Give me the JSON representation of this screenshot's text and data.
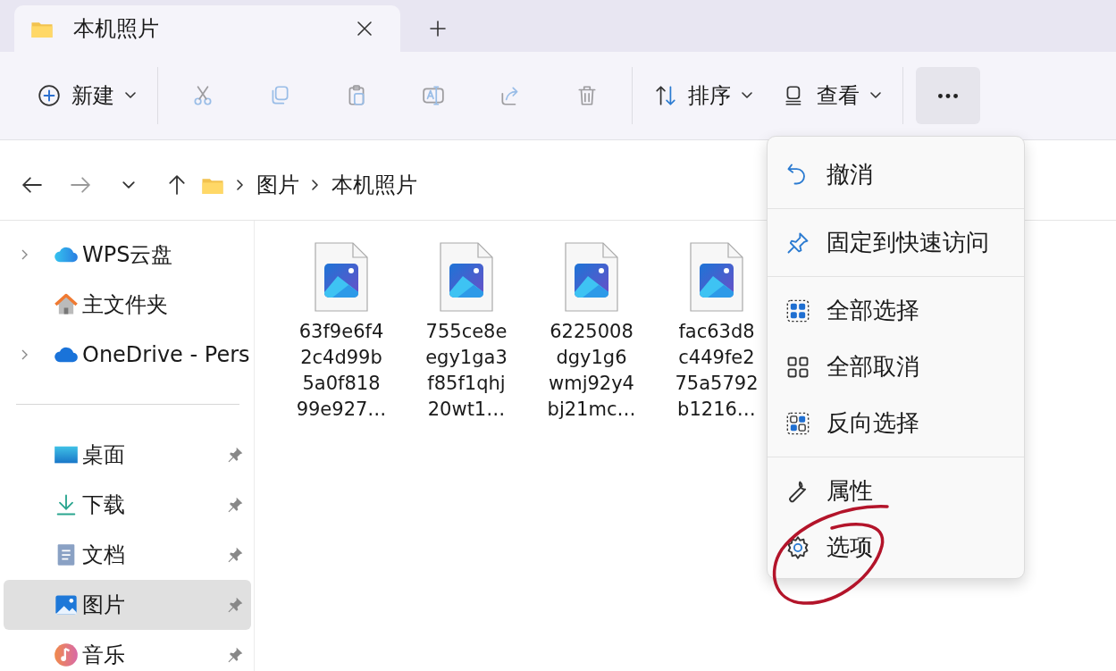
{
  "tab": {
    "title": "本机照片",
    "selected": true
  },
  "toolbar": {
    "groups": [
      [
        {
          "label": "新建",
          "dropdown": true,
          "disabled": false
        }
      ],
      [
        {
          "disabled": true
        },
        {
          "disabled": true
        },
        {
          "disabled": true
        },
        {
          "disabled": true
        },
        {
          "disabled": true
        },
        {
          "disabled": true
        }
      ],
      [
        {
          "label": "排序",
          "dropdown": true,
          "disabled": false
        },
        {
          "label": "查看",
          "dropdown": true,
          "disabled": false
        }
      ],
      [
        {
          "pressed": true,
          "disabled": false
        }
      ]
    ]
  },
  "navigation": [
    {
      "disabled": false
    },
    {
      "disabled": true
    },
    {
      "disabled": false
    },
    {
      "disabled": false
    }
  ],
  "breadcrumb": [
    "图片",
    "本机照片"
  ],
  "sidebar": {
    "sections": [
      [
        {
          "label": "WPS云盘",
          "expandable": true,
          "pinned": false,
          "selected": false
        },
        {
          "label": "主文件夹",
          "expandable": false,
          "pinned": false,
          "selected": false
        },
        {
          "label": "OneDrive - Pers",
          "expandable": true,
          "pinned": false,
          "selected": false
        }
      ],
      [
        {
          "label": "桌面",
          "expandable": false,
          "pinned": true,
          "selected": false
        },
        {
          "label": "下载",
          "expandable": false,
          "pinned": true,
          "selected": false
        },
        {
          "label": "文档",
          "expandable": false,
          "pinned": true,
          "selected": false
        },
        {
          "label": "图片",
          "expandable": false,
          "pinned": true,
          "selected": true
        },
        {
          "label": "音乐",
          "expandable": false,
          "pinned": true,
          "selected": false
        }
      ]
    ]
  },
  "files": [
    {
      "name": "63f9e6f4\n2c4d99b\n5a0f818\n99e927…"
    },
    {
      "name": "755ce8e\negy1ga3\nf85f1qhj\n20wt1…"
    },
    {
      "name": "6225008\ndgy1g6\nwmj92y4\nbj21mc…"
    },
    {
      "name": "fac63d8\nc449fe2\n75a5792\nb1216…"
    }
  ],
  "context_menu": {
    "groups": [
      [
        {
          "label": "撤消",
          "marked": false
        }
      ],
      [
        {
          "label": "固定到快速访问",
          "marked": false
        }
      ],
      [
        {
          "label": "全部选择",
          "marked": false
        },
        {
          "label": "全部取消",
          "marked": false
        },
        {
          "label": "反向选择",
          "marked": false
        }
      ],
      [
        {
          "label": "属性",
          "marked": false
        },
        {
          "label": "选项",
          "marked": true
        }
      ]
    ]
  }
}
